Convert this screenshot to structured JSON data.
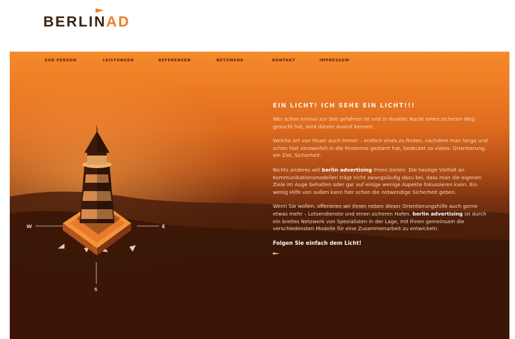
{
  "brand": {
    "part1": "BERLIN",
    "part2": "AD"
  },
  "nav": [
    {
      "label": "zur Person"
    },
    {
      "label": "Leistungen"
    },
    {
      "label": "Referenzen"
    },
    {
      "label": "Netzwerk"
    },
    {
      "label": "Kontakt"
    },
    {
      "label": "Impressum"
    }
  ],
  "compass": {
    "west": "W",
    "east": "E",
    "south": "S"
  },
  "content": {
    "headline": "Ein Licht! Ich sehe ein Licht!!!",
    "p1": "Wer schon einmal zur See gefahren ist und in dunkler Nacht einen sicheren Weg gesucht hat, wird diesen Ausruf kennen.",
    "p2": "Welche Art von Feuer auch immer – endlich eines zu finden, nachdem man lange und schon fast verzweifelt in die Finsternis gestarrt hat, bedeutet so vieles: Orientierung, ein Ziel, Sicherheit.",
    "p3_pre": "Nichts anderes will ",
    "p3_bold": "berlin advertising",
    "p3_post": " Ihnen bieten. Die heutige Vielfalt an Kommunikationsmodellen trägt nicht zwangsläufig dazu bei, dass man die eigenen Ziele im Auge behalten oder gar auf einige wenige Aspekte fokussieren kann. Ein wenig Hilfe von außen kann hier schon die notwendige Sicherheit geben.",
    "p4_pre": "Wenn Sie wollen, offerieren wir Ihnen neben dieser Orientierungshilfe auch gerne etwas mehr – Lotsendienste und einen sicheren Hafen. ",
    "p4_bold": "berlin advertising",
    "p4_post": " ist durch ein breites Netzwerk von Spezialisten in der Lage, mit Ihnen gemeinsam die verschiedensten Modelle für eine Zusammenarbeit zu entwickeln.",
    "cta": "Folgen Sie einfach dem Licht!"
  },
  "colors": {
    "accent": "#f07b27",
    "brand_dark": "#3b2316",
    "nav_text": "#5a2008",
    "background_top": "#f58a2c",
    "background_bottom": "#2c1106"
  },
  "icons": {
    "logo_flag": "flag-icon",
    "cta_arrow": "arrow-right-icon"
  }
}
